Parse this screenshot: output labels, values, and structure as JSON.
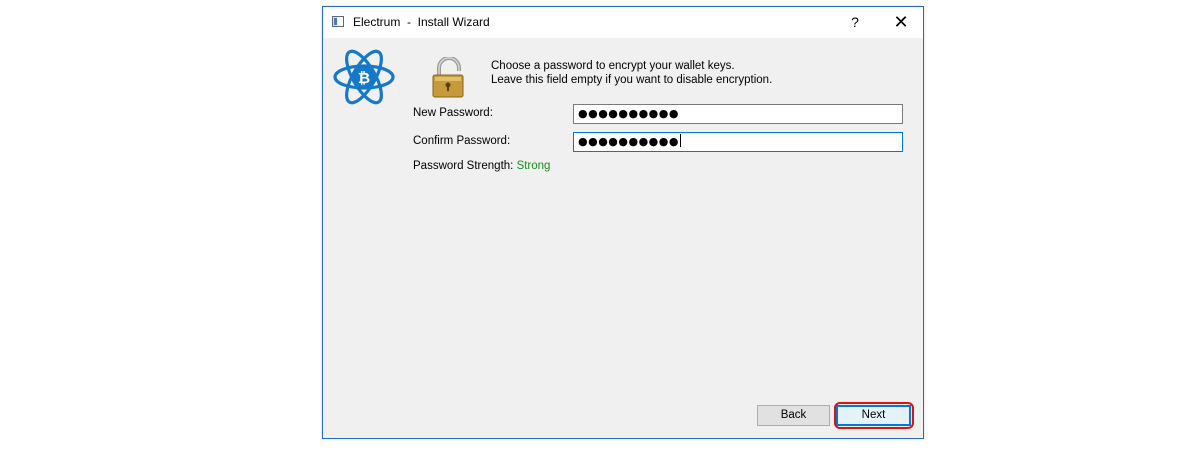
{
  "window": {
    "title": "Electrum  -  Install Wizard",
    "help_label": "?",
    "close_label": "✕",
    "accent_color": "#1d6fb8"
  },
  "instructions": {
    "line1": "Choose a password to encrypt your wallet keys.",
    "line2": "Leave this field empty if you want to disable encryption."
  },
  "form": {
    "new_password_label": "New Password:",
    "new_password_value": "●●●●●●●●●●",
    "confirm_password_label": "Confirm Password:",
    "confirm_password_value": "●●●●●●●●●●",
    "strength_label": "Password Strength: ",
    "strength_value": "Strong",
    "strength_color": "#1b8a1b"
  },
  "buttons": {
    "back_label": "Back",
    "next_label": "Next"
  },
  "icons": {
    "app": "electrum-window-icon",
    "logo": "electrum-bitcoin-atom-logo",
    "lock": "open-padlock-icon"
  },
  "annotation": {
    "highlight_color": "#d9121b"
  }
}
